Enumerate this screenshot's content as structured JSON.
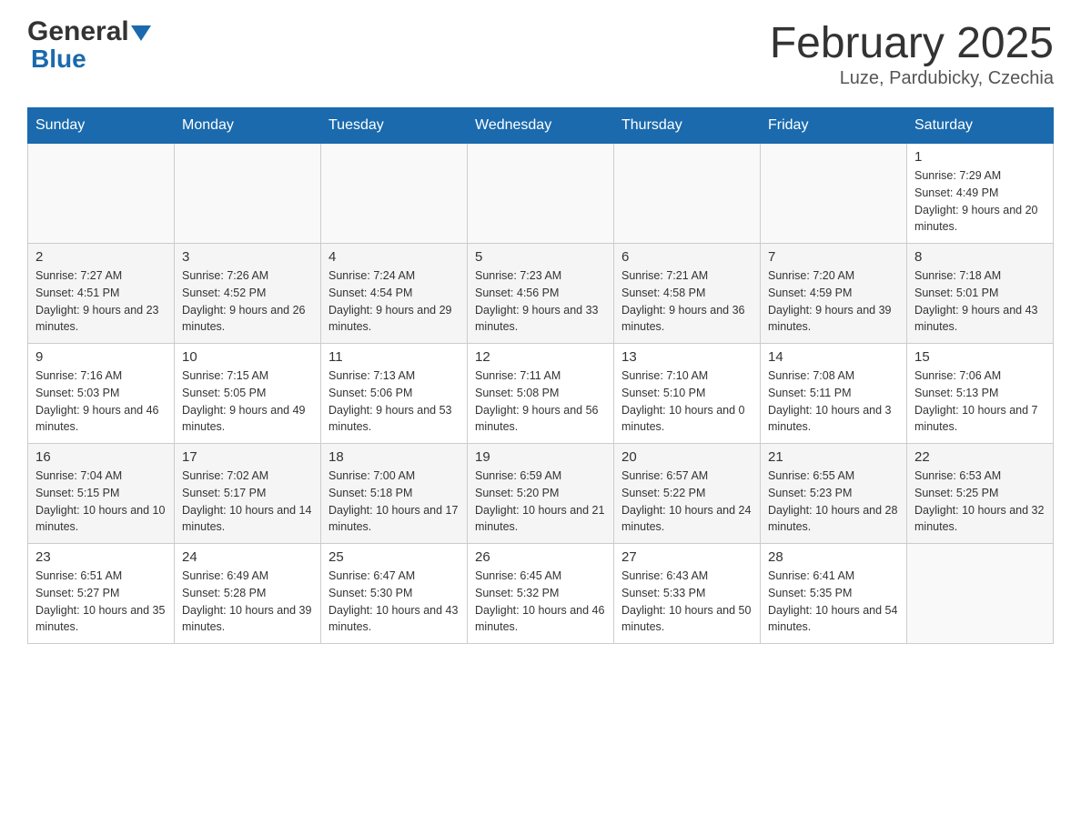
{
  "header": {
    "logo_general": "General",
    "logo_blue": "Blue",
    "month_title": "February 2025",
    "location": "Luze, Pardubicky, Czechia"
  },
  "days_of_week": [
    "Sunday",
    "Monday",
    "Tuesday",
    "Wednesday",
    "Thursday",
    "Friday",
    "Saturday"
  ],
  "weeks": [
    {
      "days": [
        {
          "num": "",
          "info": ""
        },
        {
          "num": "",
          "info": ""
        },
        {
          "num": "",
          "info": ""
        },
        {
          "num": "",
          "info": ""
        },
        {
          "num": "",
          "info": ""
        },
        {
          "num": "",
          "info": ""
        },
        {
          "num": "1",
          "info": "Sunrise: 7:29 AM\nSunset: 4:49 PM\nDaylight: 9 hours and 20 minutes."
        }
      ]
    },
    {
      "days": [
        {
          "num": "2",
          "info": "Sunrise: 7:27 AM\nSunset: 4:51 PM\nDaylight: 9 hours and 23 minutes."
        },
        {
          "num": "3",
          "info": "Sunrise: 7:26 AM\nSunset: 4:52 PM\nDaylight: 9 hours and 26 minutes."
        },
        {
          "num": "4",
          "info": "Sunrise: 7:24 AM\nSunset: 4:54 PM\nDaylight: 9 hours and 29 minutes."
        },
        {
          "num": "5",
          "info": "Sunrise: 7:23 AM\nSunset: 4:56 PM\nDaylight: 9 hours and 33 minutes."
        },
        {
          "num": "6",
          "info": "Sunrise: 7:21 AM\nSunset: 4:58 PM\nDaylight: 9 hours and 36 minutes."
        },
        {
          "num": "7",
          "info": "Sunrise: 7:20 AM\nSunset: 4:59 PM\nDaylight: 9 hours and 39 minutes."
        },
        {
          "num": "8",
          "info": "Sunrise: 7:18 AM\nSunset: 5:01 PM\nDaylight: 9 hours and 43 minutes."
        }
      ]
    },
    {
      "days": [
        {
          "num": "9",
          "info": "Sunrise: 7:16 AM\nSunset: 5:03 PM\nDaylight: 9 hours and 46 minutes."
        },
        {
          "num": "10",
          "info": "Sunrise: 7:15 AM\nSunset: 5:05 PM\nDaylight: 9 hours and 49 minutes."
        },
        {
          "num": "11",
          "info": "Sunrise: 7:13 AM\nSunset: 5:06 PM\nDaylight: 9 hours and 53 minutes."
        },
        {
          "num": "12",
          "info": "Sunrise: 7:11 AM\nSunset: 5:08 PM\nDaylight: 9 hours and 56 minutes."
        },
        {
          "num": "13",
          "info": "Sunrise: 7:10 AM\nSunset: 5:10 PM\nDaylight: 10 hours and 0 minutes."
        },
        {
          "num": "14",
          "info": "Sunrise: 7:08 AM\nSunset: 5:11 PM\nDaylight: 10 hours and 3 minutes."
        },
        {
          "num": "15",
          "info": "Sunrise: 7:06 AM\nSunset: 5:13 PM\nDaylight: 10 hours and 7 minutes."
        }
      ]
    },
    {
      "days": [
        {
          "num": "16",
          "info": "Sunrise: 7:04 AM\nSunset: 5:15 PM\nDaylight: 10 hours and 10 minutes."
        },
        {
          "num": "17",
          "info": "Sunrise: 7:02 AM\nSunset: 5:17 PM\nDaylight: 10 hours and 14 minutes."
        },
        {
          "num": "18",
          "info": "Sunrise: 7:00 AM\nSunset: 5:18 PM\nDaylight: 10 hours and 17 minutes."
        },
        {
          "num": "19",
          "info": "Sunrise: 6:59 AM\nSunset: 5:20 PM\nDaylight: 10 hours and 21 minutes."
        },
        {
          "num": "20",
          "info": "Sunrise: 6:57 AM\nSunset: 5:22 PM\nDaylight: 10 hours and 24 minutes."
        },
        {
          "num": "21",
          "info": "Sunrise: 6:55 AM\nSunset: 5:23 PM\nDaylight: 10 hours and 28 minutes."
        },
        {
          "num": "22",
          "info": "Sunrise: 6:53 AM\nSunset: 5:25 PM\nDaylight: 10 hours and 32 minutes."
        }
      ]
    },
    {
      "days": [
        {
          "num": "23",
          "info": "Sunrise: 6:51 AM\nSunset: 5:27 PM\nDaylight: 10 hours and 35 minutes."
        },
        {
          "num": "24",
          "info": "Sunrise: 6:49 AM\nSunset: 5:28 PM\nDaylight: 10 hours and 39 minutes."
        },
        {
          "num": "25",
          "info": "Sunrise: 6:47 AM\nSunset: 5:30 PM\nDaylight: 10 hours and 43 minutes."
        },
        {
          "num": "26",
          "info": "Sunrise: 6:45 AM\nSunset: 5:32 PM\nDaylight: 10 hours and 46 minutes."
        },
        {
          "num": "27",
          "info": "Sunrise: 6:43 AM\nSunset: 5:33 PM\nDaylight: 10 hours and 50 minutes."
        },
        {
          "num": "28",
          "info": "Sunrise: 6:41 AM\nSunset: 5:35 PM\nDaylight: 10 hours and 54 minutes."
        },
        {
          "num": "",
          "info": ""
        }
      ]
    }
  ]
}
